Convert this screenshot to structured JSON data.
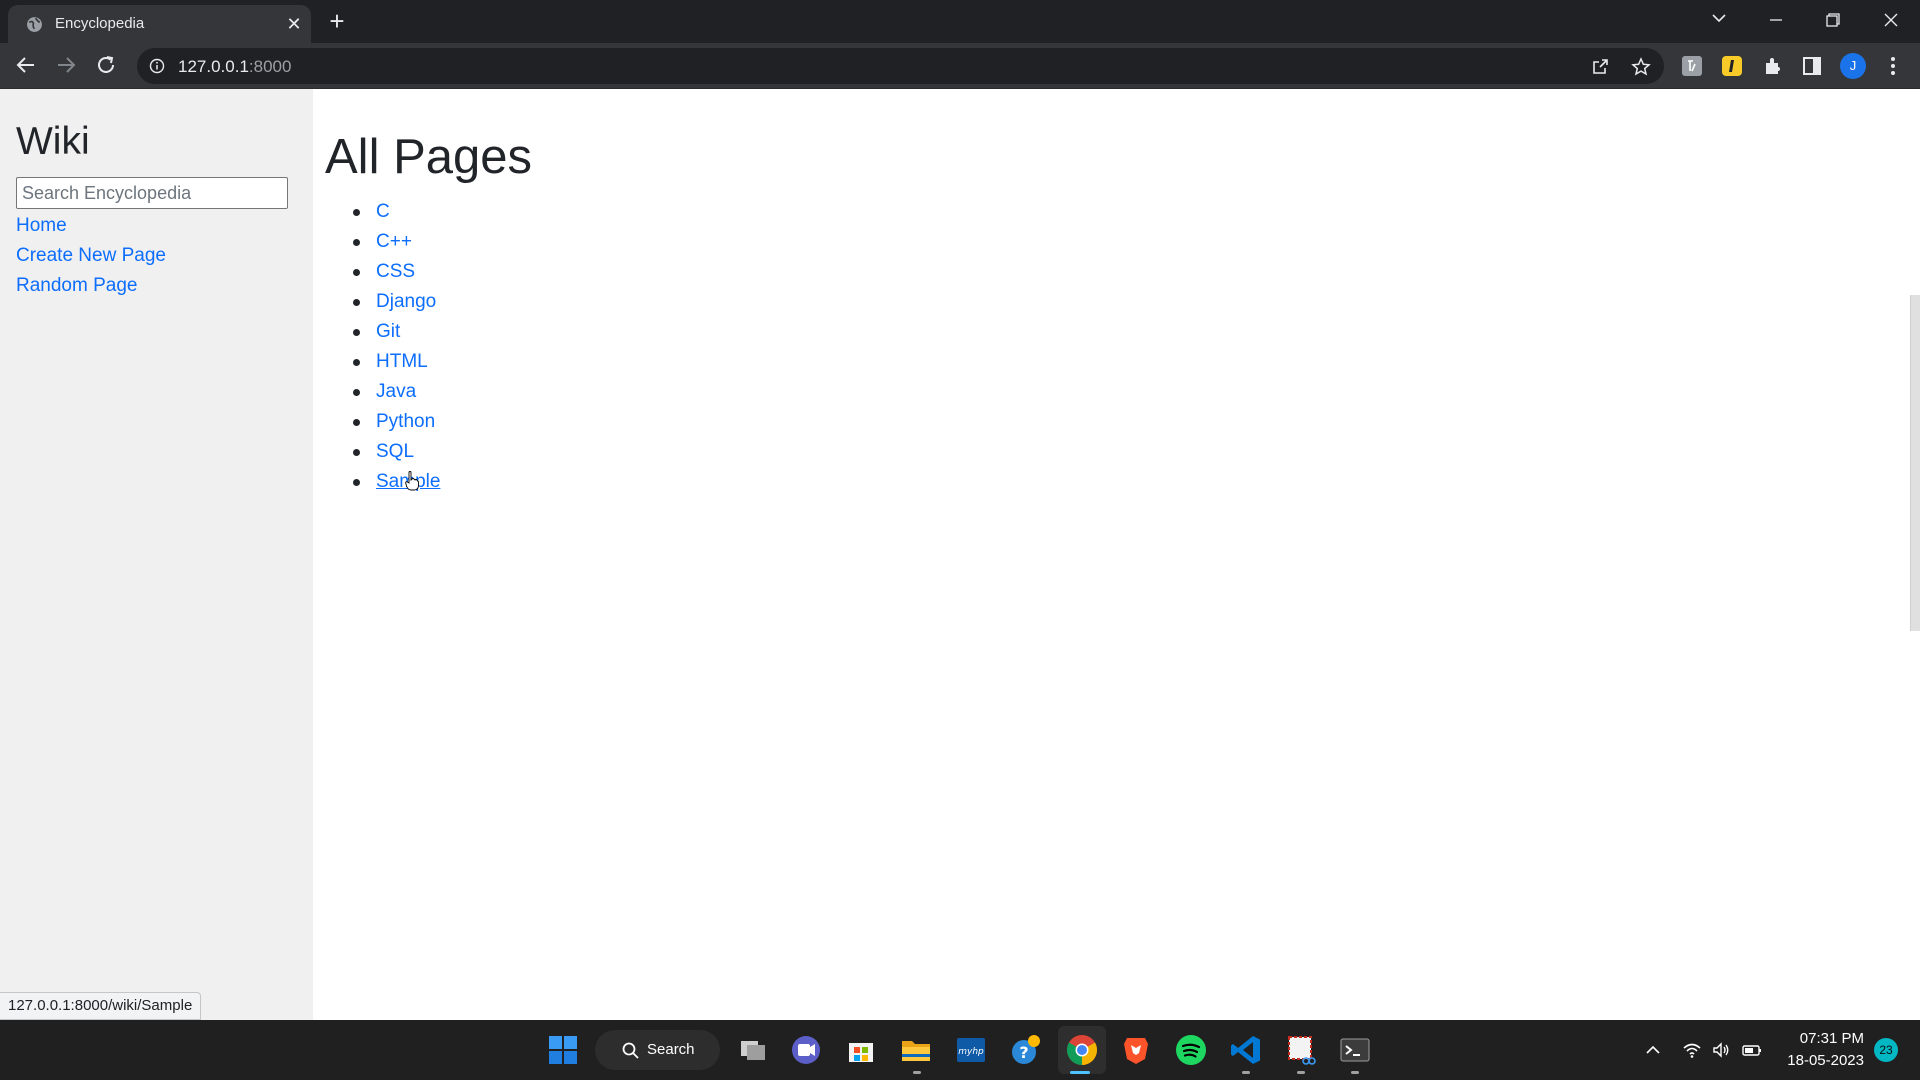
{
  "browser": {
    "tab_title": "Encyclopedia",
    "url_host": "127.0.0.1",
    "url_port": ":8000",
    "avatar_letter": "J"
  },
  "sidebar": {
    "title": "Wiki",
    "search_placeholder": "Search Encyclopedia",
    "links": [
      "Home",
      "Create New Page",
      "Random Page"
    ]
  },
  "main": {
    "heading": "All Pages",
    "pages": [
      "C",
      "C++",
      "CSS",
      "Django",
      "Git",
      "HTML",
      "Java",
      "Python",
      "SQL",
      "Sample"
    ]
  },
  "status_bar": {
    "hover_url": "127.0.0.1:8000/wiki/Sample"
  },
  "taskbar": {
    "search_label": "Search",
    "time": "07:31 PM",
    "date": "18-05-2023",
    "notification_count": "23"
  },
  "colors": {
    "link": "#0d6efd",
    "sidebar_bg": "#f0f0f0",
    "chrome_dark": "#202124",
    "chrome_toolbar": "#35363a",
    "taskbar": "#202020"
  }
}
